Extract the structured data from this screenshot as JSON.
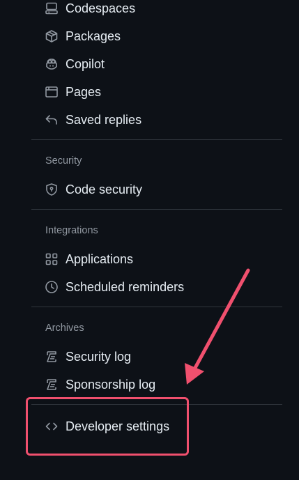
{
  "menu": {
    "codespaces": "Codespaces",
    "packages": "Packages",
    "copilot": "Copilot",
    "pages": "Pages",
    "saved_replies": "Saved replies"
  },
  "security": {
    "heading": "Security",
    "code_security": "Code security"
  },
  "integrations": {
    "heading": "Integrations",
    "applications": "Applications",
    "scheduled_reminders": "Scheduled reminders"
  },
  "archives": {
    "heading": "Archives",
    "security_log": "Security log",
    "sponsorship_log": "Sponsorship log"
  },
  "developer": {
    "label": "Developer settings"
  },
  "colors": {
    "background": "#0d1117",
    "text": "#e6edf3",
    "muted": "#9198a1",
    "divider": "#30363d",
    "annotation": "#f0506e"
  }
}
